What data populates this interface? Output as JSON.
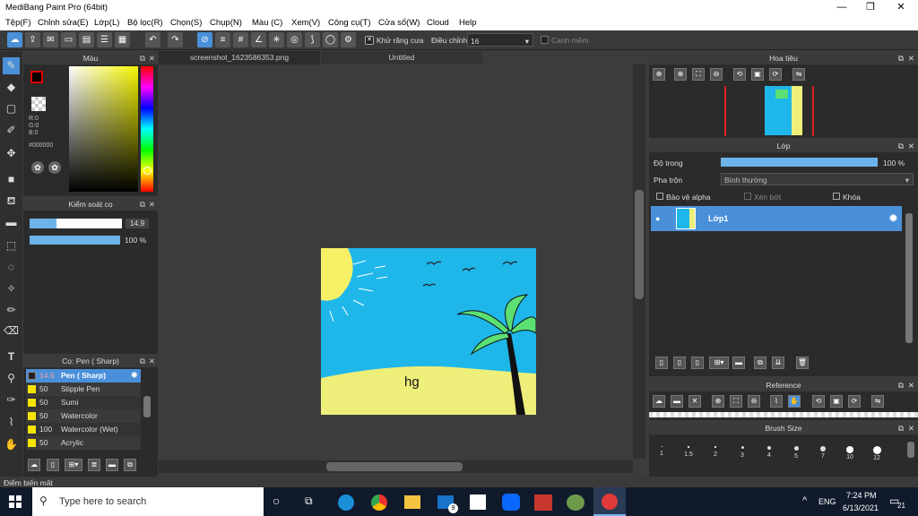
{
  "window": {
    "title": "MediBang Paint Pro (64bit)",
    "min": "—",
    "max": "❐",
    "close": "✕"
  },
  "menu": [
    "Tệp(F)",
    "Chỉnh sửa(E)",
    "Lớp(L)",
    "Bộ lọc(R)",
    "Chọn(S)",
    "Chụp(N)",
    "Màu (C)",
    "Xem(V)",
    "Công cụ(T)",
    "Cửa sổ(W)",
    "Cloud",
    "Help"
  ],
  "toolbar": {
    "antialias_label": "Khử răng cưa",
    "correction_label": "Điều chỉnh",
    "correction_value": "16",
    "edge_label": "Canh mềm"
  },
  "color_panel": {
    "title": "Màu",
    "r": "R:0",
    "g": "G:0",
    "b": "B:0",
    "hex": "#000000",
    "fg_color": "#000000",
    "bg_color": "#e00000"
  },
  "brush_control": {
    "title": "Kiểm soát cọ",
    "size_value": "14.9",
    "opacity_value": "100 %"
  },
  "brush_panel": {
    "title": "Cọ: Pen ( Sharp)",
    "items": [
      {
        "size": "14.9",
        "name": "Pen ( Sharp)"
      },
      {
        "size": "50",
        "name": "Stipple Pen"
      },
      {
        "size": "50",
        "name": "Sumi"
      },
      {
        "size": "50",
        "name": "Watercolor"
      },
      {
        "size": "100",
        "name": "Watercolor (Wet)"
      },
      {
        "size": "50",
        "name": "Acrylic"
      }
    ]
  },
  "tabs": [
    {
      "label": "screenshot_1623586353.png"
    },
    {
      "label": "Untitled"
    }
  ],
  "drawing_text": "hg",
  "navigator": {
    "title": "Hoa tiêu"
  },
  "layer_panel": {
    "title": "Lớp",
    "opacity_label": "Độ trong",
    "opacity_value": "100 %",
    "blend_label": "Pha trộn",
    "blend_value": "Bình thường",
    "protect_alpha": "Bảo vệ alpha",
    "clipping": "Xén bớt",
    "lock": "Khóa",
    "layer_name": "Lớp1"
  },
  "reference": {
    "title": "Reference"
  },
  "brush_size": {
    "title": "Brush Size",
    "sizes": [
      "1",
      "1.5",
      "2",
      "3",
      "4",
      "5",
      "7",
      "10",
      "12"
    ]
  },
  "status": {
    "text": "Điểm biến mất"
  },
  "taskbar": {
    "search_placeholder": "Type here to search",
    "lang": "ENG",
    "time": "7:24 PM",
    "date": "6/13/2021",
    "notif": "21",
    "mail_badge": "9"
  }
}
